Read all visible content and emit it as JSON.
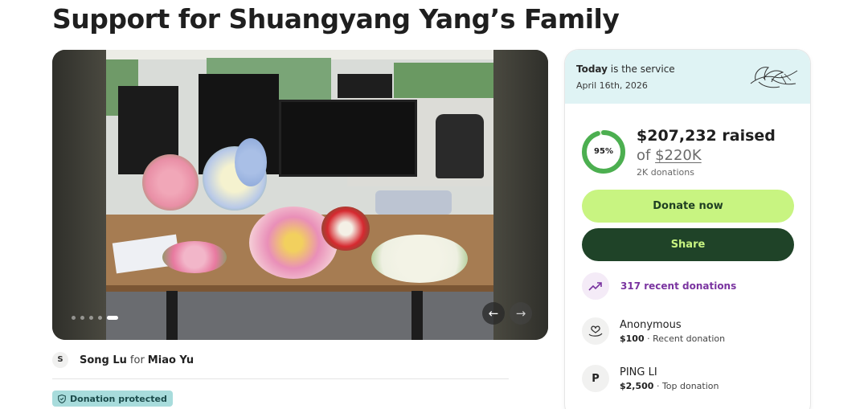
{
  "page": {
    "title": "Support for Shuangyang Yang’s Family"
  },
  "gallery": {
    "prev_icon": "←",
    "next_icon": "→",
    "slide_count": 5,
    "active_slide": 5
  },
  "organizer": {
    "avatar_initial": "S",
    "name": "Song Lu",
    "for_text": "for",
    "beneficiary": "Miao Yu"
  },
  "badge": {
    "label": "Donation protected"
  },
  "service": {
    "today_label": "Today",
    "today_suffix": " is the service",
    "date": "April 16th, 2026"
  },
  "progress": {
    "percent_label": "95%",
    "percent_value": 0.95,
    "raised_amount": "$207,232",
    "raised_suffix": " raised",
    "goal_prefix": "of ",
    "goal_amount": "$220K",
    "donation_count": "2K donations"
  },
  "actions": {
    "donate_label": "Donate now",
    "share_label": "Share"
  },
  "recent": {
    "label": "317 recent donations"
  },
  "donors": [
    {
      "name": "Anonymous",
      "amount": "$100",
      "note": " · Recent donation",
      "avatar": ""
    },
    {
      "name": "PING LI",
      "amount": "$2,500",
      "note": " · Top donation",
      "avatar": "P"
    }
  ],
  "colors": {
    "accent_green": "#c8f481",
    "dark_green": "#1f4328",
    "ring_green": "#4caf50",
    "purple": "#7a34a0",
    "service_bg": "#dff3f4",
    "badge_bg": "#a8dcdc"
  }
}
